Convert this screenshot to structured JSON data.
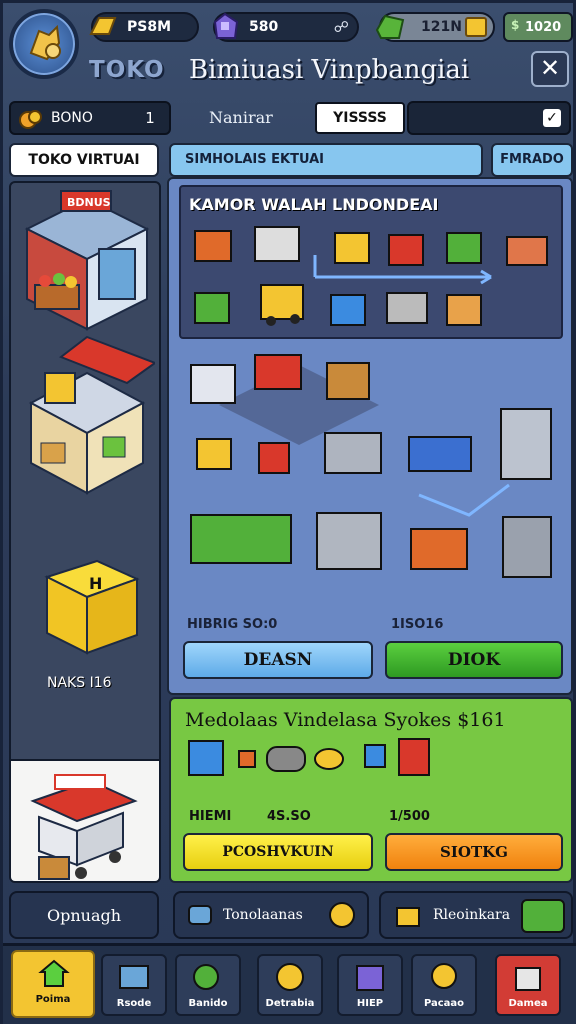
{
  "header": {
    "gold": "PS8M",
    "gems": "580",
    "cash": "121N",
    "money": "1020",
    "brand": "TOKO",
    "title": "Bimiuasi Vinpbangiai"
  },
  "filter": {
    "bonus_label": "BONO",
    "bonus_count": "1",
    "filter_label": "Nanirar",
    "input_value": "YISSSS",
    "select_value": ""
  },
  "sidebar": {
    "tab_label": "TOKO VIRTUAI",
    "shop_sign": "BDNUS",
    "item_label": "NAKS I16"
  },
  "main": {
    "tab_label": "SIMHOLAIS EKTUAI",
    "tab2_label": "FMRADO",
    "map_title": "KAMOR WALAH LNDONDEAI",
    "price_left": "HIBRIG SO:0",
    "price_right": "1ISO16",
    "btn_left": "DEASN",
    "btn_right": "DIOK"
  },
  "stock": {
    "title": "Medolaas Vindelasa Syokes $161",
    "label_l": "HIEMI",
    "label_m": "4S.SO",
    "label_r": "1/500",
    "btn_left": "PCOSHVKUIN",
    "btn_right": "SIOTKG"
  },
  "actions": {
    "a1": "Opnuagh",
    "a2": "Tonolaanas",
    "a3": "Rleoinkara"
  },
  "nav": {
    "items": [
      {
        "label": "Poima",
        "icon": "home-icon"
      },
      {
        "label": "Rsode",
        "icon": "shop-icon"
      },
      {
        "label": "Banido",
        "icon": "money-icon"
      },
      {
        "label": "Detrabia",
        "icon": "coin-icon"
      },
      {
        "label": "HIEP",
        "icon": "box-icon"
      },
      {
        "label": "Pacaao",
        "icon": "trophy-icon"
      },
      {
        "label": "Damea",
        "icon": "gift-icon"
      }
    ]
  },
  "colors": {
    "panel_blue": "#6a88c4",
    "stock_green": "#78c843",
    "tab_blue": "#87c6ef",
    "gold": "#f3c531"
  }
}
